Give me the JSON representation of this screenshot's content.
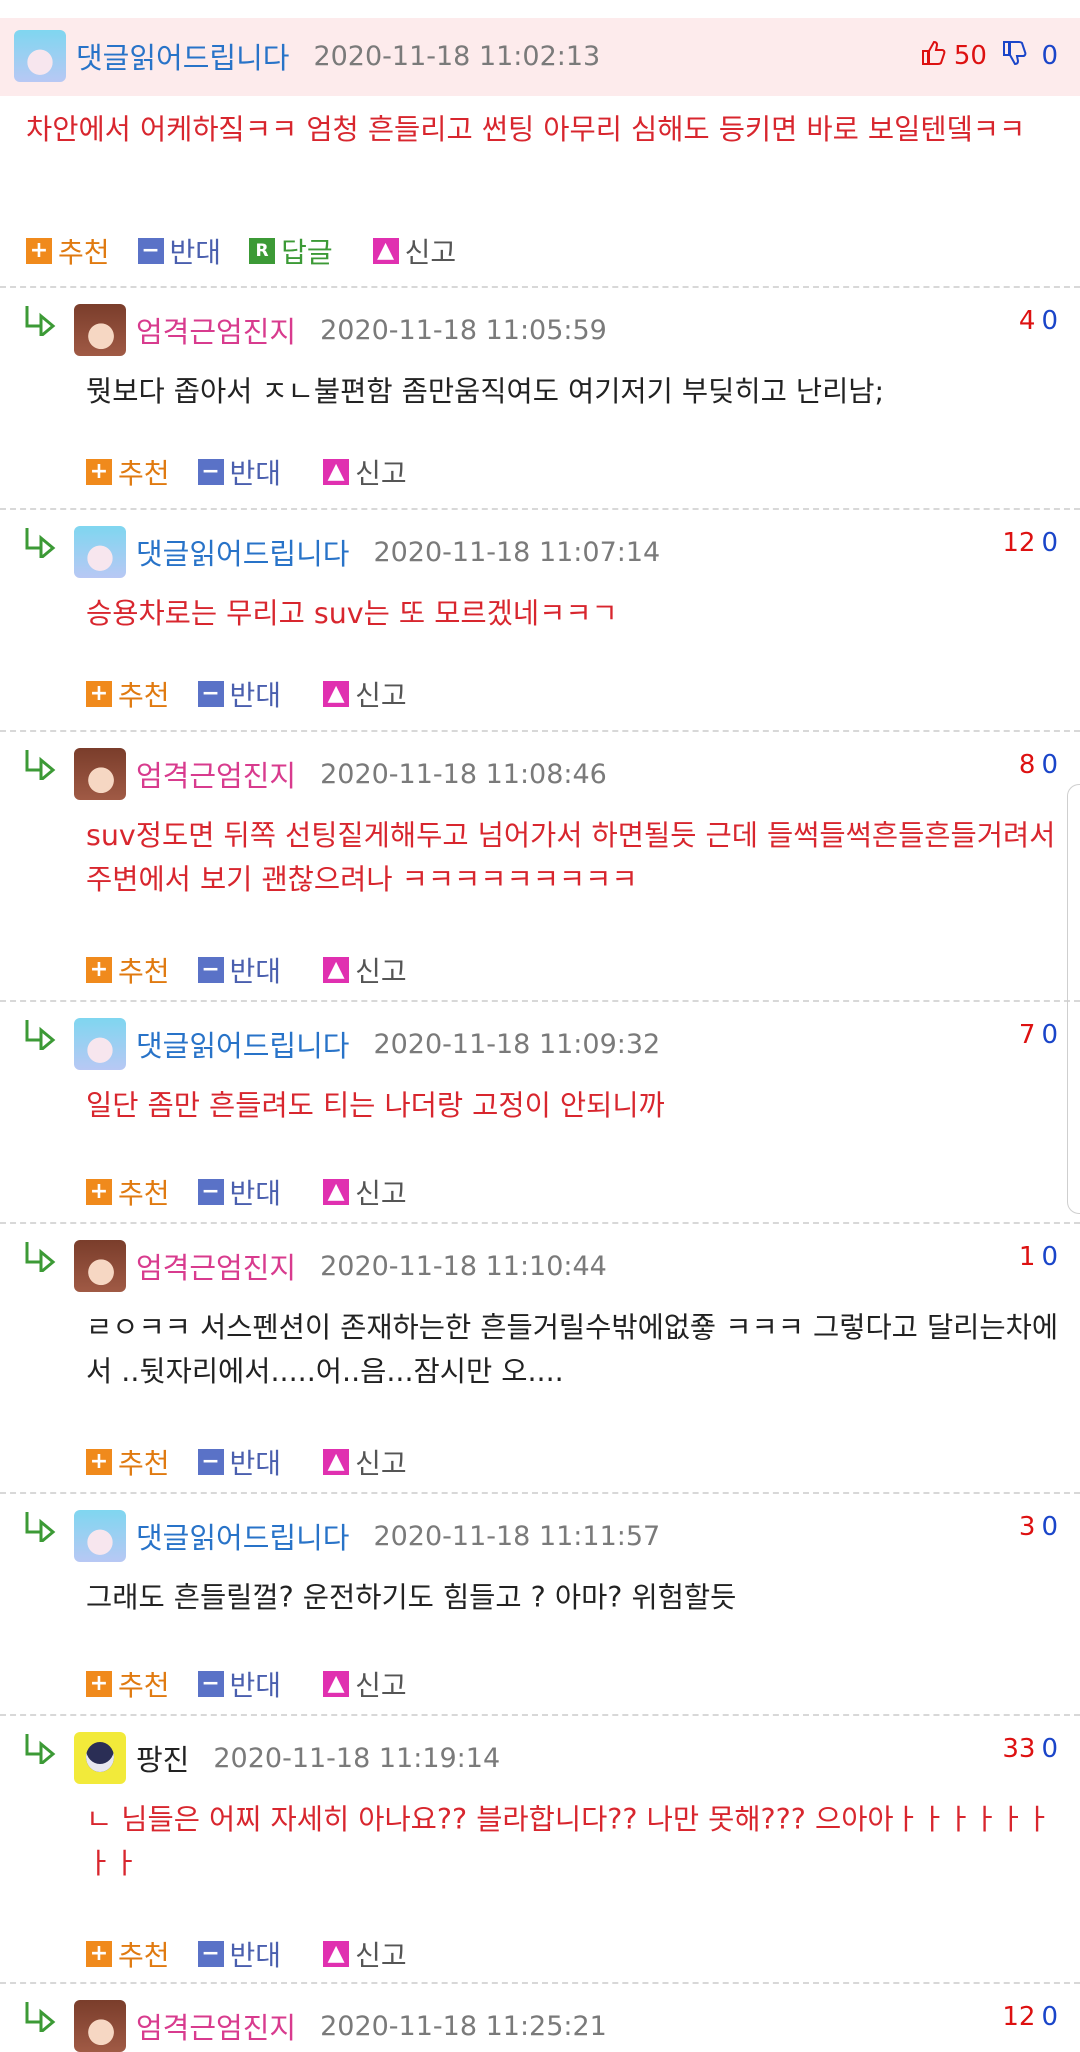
{
  "main_comment": {
    "author": "댓글읽어드립니다",
    "date": "2020-11-18 11:02:13",
    "up": "50",
    "down": "0",
    "text": "차안에서 어케하짘ㅋㅋ 엄청 흔들리고 썬팅 아무리 심해도 등키면 바로 보일텐뎈ㅋㅋ",
    "actions": {
      "recommend": "추천",
      "oppose": "반대",
      "reply": "답글",
      "report": "신고"
    }
  },
  "replies": [
    {
      "author": "엄격근엄진지",
      "date": "2020-11-18 11:05:59",
      "up": "4",
      "down": "0",
      "text": "뭣보다 좁아서 ㅈㄴ불편함 좀만움직여도 여기저기 부딪히고 난리남;",
      "color": "black",
      "avatar": "brown"
    },
    {
      "author": "댓글읽어드립니다",
      "date": "2020-11-18 11:07:14",
      "up": "12",
      "down": "0",
      "text": "승용차로는 무리고 suv는 또 모르겠네ㅋㅋㄱ",
      "color": "red",
      "avatar": "blue"
    },
    {
      "author": "엄격근엄진지",
      "date": "2020-11-18 11:08:46",
      "up": "8",
      "down": "0",
      "text": "suv정도면 뒤쪽 선팅짙게해두고 넘어가서 하면될듯 근데 들썩들썩흔들흔들거려서 주변에서 보기 괜찮으려나 ㅋㅋㅋㅋㅋㅋㅋㅋㅋ",
      "color": "red",
      "avatar": "brown"
    },
    {
      "author": "댓글읽어드립니다",
      "date": "2020-11-18 11:09:32",
      "up": "7",
      "down": "0",
      "text": "일단 좀만 흔들려도 티는 나더랑 고정이 안되니까",
      "color": "red",
      "avatar": "blue"
    },
    {
      "author": "엄격근엄진지",
      "date": "2020-11-18 11:10:44",
      "up": "1",
      "down": "0",
      "text": "ㄹㅇㅋㅋ 서스펜션이 존재하는한 흔들거릴수밖에없죻 ㅋㅋㅋ 그렇다고 달리는차에서 ..뒷자리에서.....어..음...잠시만 오....",
      "color": "black",
      "avatar": "brown"
    },
    {
      "author": "댓글읽어드립니다",
      "date": "2020-11-18 11:11:57",
      "up": "3",
      "down": "0",
      "text": "그래도 흔들릴껄? 운전하기도 힘들고 ? 아마? 위험할듯",
      "color": "black",
      "avatar": "blue"
    },
    {
      "author": "팡진",
      "date": "2020-11-18 11:19:14",
      "up": "33",
      "down": "0",
      "text": "ㄴ 님들은 어찌 자세히 아나요?? 블라합니다?? 나만 못해??? 으아아ㅏㅏㅏㅏㅏㅏㅏㅏ",
      "color": "red",
      "avatar": "yellow"
    },
    {
      "author": "엄격근엄진지",
      "date": "2020-11-18 11:25:21",
      "up": "12",
      "down": "0",
      "text": "",
      "color": "black",
      "avatar": "brown"
    }
  ],
  "reply_actions": {
    "recommend": "추천",
    "oppose": "반대",
    "report": "신고"
  }
}
